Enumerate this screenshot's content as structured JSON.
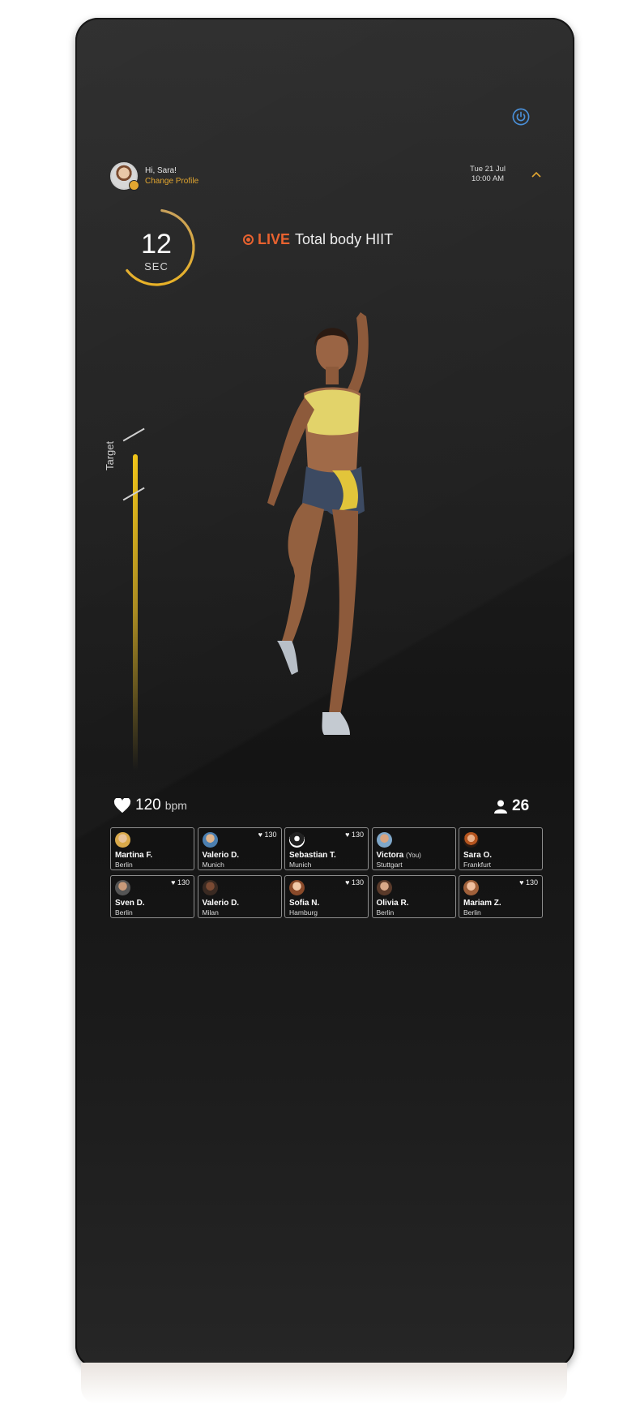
{
  "profile": {
    "greeting": "Hi, Sara!",
    "change_label": "Change Profile"
  },
  "datetime": {
    "date": "Tue 21 Jul",
    "time": "10:00 AM"
  },
  "icons": {
    "power": "power-icon",
    "collapse": "chevron-up-icon",
    "heart": "heart-icon",
    "people": "person-icon"
  },
  "timer": {
    "value": "12",
    "unit": "SEC",
    "progress": 0.62
  },
  "live": {
    "label": "LIVE",
    "title": "Total body HIIT"
  },
  "target": {
    "label": "Target"
  },
  "heart_rate": {
    "value": "120",
    "unit": "bpm"
  },
  "participants_count": "26",
  "colors": {
    "accent": "#e2a630",
    "live": "#e8622f",
    "power": "#4a90d9"
  },
  "participants": [
    {
      "name": "Martina F.",
      "city": "Berlin",
      "hr": "",
      "you": ""
    },
    {
      "name": "Valerio D.",
      "city": "Munich",
      "hr": "130",
      "you": ""
    },
    {
      "name": "Sebastian T.",
      "city": "Munich",
      "hr": "130",
      "you": ""
    },
    {
      "name": "Victora",
      "city": "Stuttgart",
      "hr": "",
      "you": "(You)"
    },
    {
      "name": "Sara O.",
      "city": "Frankfurt",
      "hr": "",
      "you": ""
    },
    {
      "name": "Sven D.",
      "city": "Berlin",
      "hr": "130",
      "you": ""
    },
    {
      "name": "Valerio D.",
      "city": "Milan",
      "hr": "",
      "you": ""
    },
    {
      "name": "Sofia N.",
      "city": "Hamburg",
      "hr": "130",
      "you": ""
    },
    {
      "name": "Olivia R.",
      "city": "Berlin",
      "hr": "",
      "you": ""
    },
    {
      "name": "Mariam Z.",
      "city": "Berlin",
      "hr": "130",
      "you": ""
    }
  ]
}
